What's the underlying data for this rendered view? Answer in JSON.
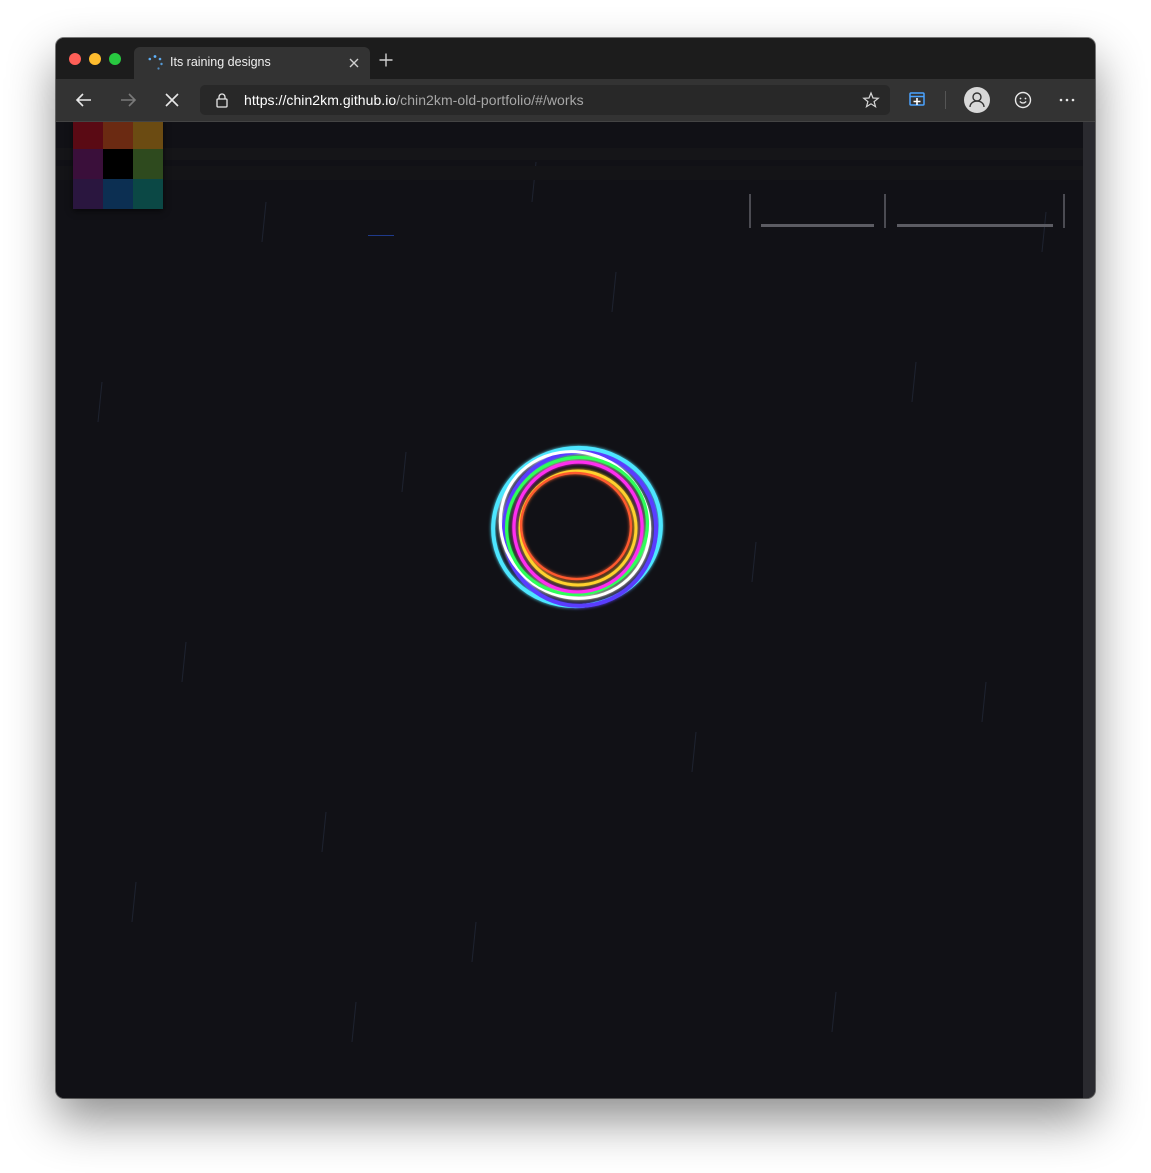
{
  "browser": {
    "tab_title": "Its raining designs",
    "url_scheme": "https://",
    "url_host": "chin2km.github.io",
    "url_path": "/chin2km-old-portfolio/#/works"
  },
  "icons": {
    "tab_loading": "loading-spinner-icon",
    "tab_close": "close-icon",
    "new_tab": "plus-icon",
    "back": "arrow-left-icon",
    "forward": "arrow-right-icon",
    "stop": "stop-x-icon",
    "lock": "lock-icon",
    "favorite": "star-icon",
    "collections": "collections-icon",
    "profile": "person-icon",
    "feedback": "smiley-icon",
    "more": "ellipsis-icon"
  },
  "page": {
    "background": "#111116",
    "color_swatches": [
      "#5a0a14",
      "#6b2a12",
      "#6b4b12",
      "#3a0f3a",
      "#000000",
      "#2e4a1e",
      "#2a163f",
      "#0c2f52",
      "#0b4845"
    ],
    "loader_ring_colors": [
      "#4ee6ff",
      "#5a3cff",
      "#ff2ef0",
      "#2eff5a",
      "#ffd12e",
      "#ff5a2e",
      "#ffffff"
    ]
  }
}
